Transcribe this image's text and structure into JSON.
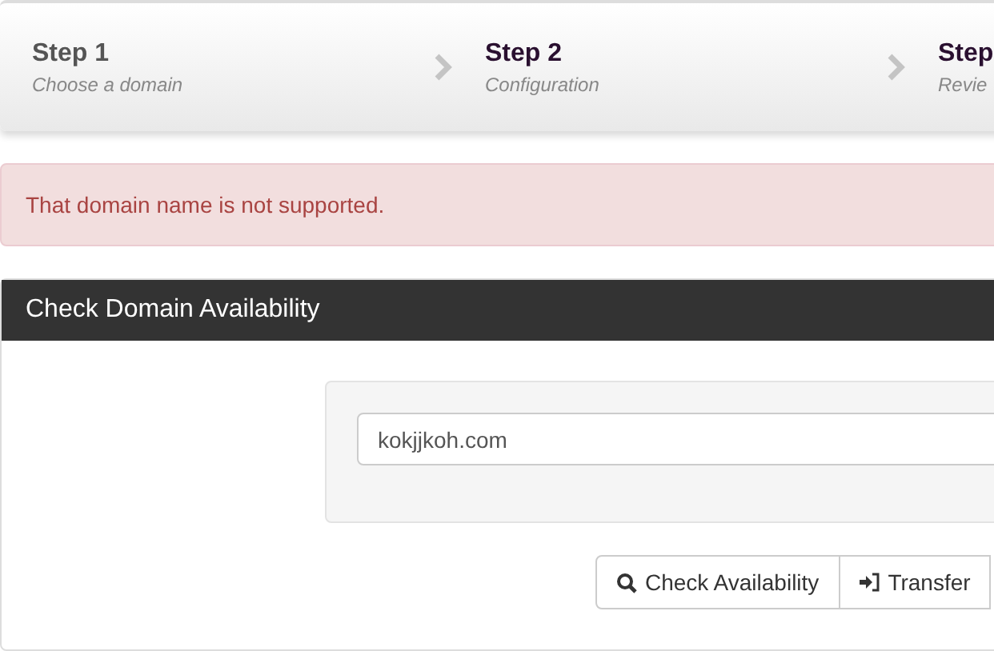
{
  "steps": [
    {
      "title": "Step 1",
      "subtitle": "Choose a domain",
      "selected": true
    },
    {
      "title": "Step 2",
      "subtitle": "Configuration",
      "selected": false
    },
    {
      "title": "Step",
      "subtitle": "Revie",
      "selected": false
    }
  ],
  "alert": {
    "message": "That domain name is not supported."
  },
  "panel": {
    "title": "Check Domain Availability",
    "domain_input": {
      "value": "kokjjkoh.com"
    },
    "buttons": [
      {
        "label": "Check Availability",
        "kind": "search"
      },
      {
        "label": "Transfer",
        "kind": "transfer"
      }
    ]
  }
}
